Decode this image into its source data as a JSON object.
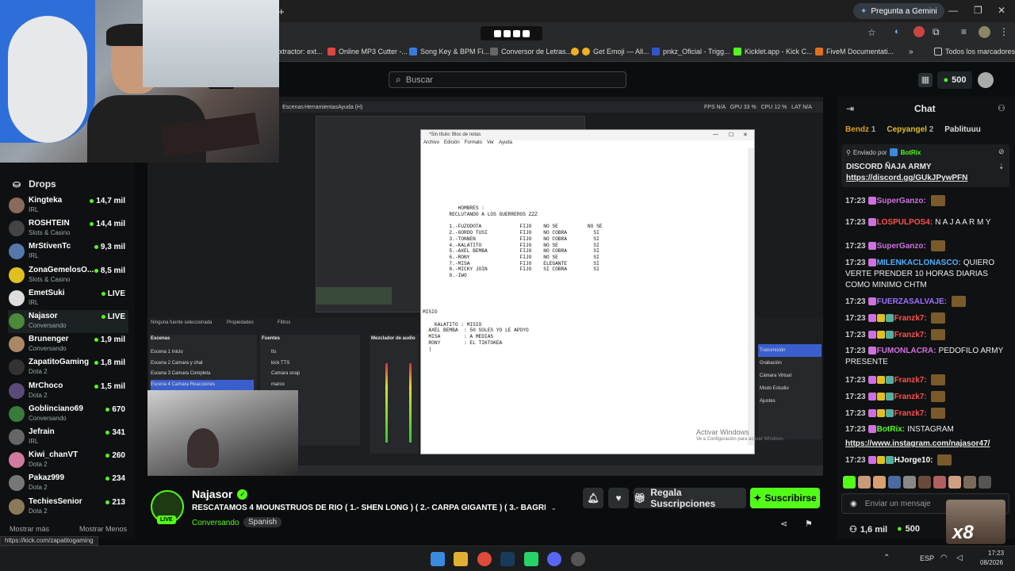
{
  "browser": {
    "ask_gemini": "Pregunta a Gemini",
    "bookmarks": [
      {
        "label": "xtractor: ext...",
        "color": "#888"
      },
      {
        "label": "Online MP3 Cutter -...",
        "color": "#e04444"
      },
      {
        "label": "Song Key & BPM Fi...",
        "color": "#3a7ae0"
      },
      {
        "label": "Conversor de Letras...",
        "color": "#666"
      },
      {
        "label": "Get Emoji — All...",
        "color": "#f0b020"
      },
      {
        "label": "pnkz_Oficial - Trigg...",
        "color": "#3355cc"
      },
      {
        "label": "Kicklet.app - Kick C...",
        "color": "#53fc18"
      },
      {
        "label": "FiveM Documentati...",
        "color": "#e07020"
      }
    ],
    "all_bookmarks": "Todos los marcadores",
    "status_url": "https://kick.com/zapatitogaming"
  },
  "header": {
    "search_placeholder": "Buscar",
    "points": "500"
  },
  "sidebar": {
    "drops_label": "Drops",
    "channels": [
      {
        "name": "Kingteka",
        "category": "IRL",
        "viewers": "14,7 mil",
        "color": "#8a6a5a"
      },
      {
        "name": "ROSHTEIN",
        "category": "Slots & Casino",
        "viewers": "14,4 mil",
        "color": "#444"
      },
      {
        "name": "MrStivenTc",
        "category": "IRL",
        "viewers": "9,3 mil",
        "color": "#5577aa"
      },
      {
        "name": "ZonaGemelosO...",
        "category": "Slots & Casino",
        "viewers": "8,5 mil",
        "color": "#e0c020"
      },
      {
        "name": "EmetSuki",
        "category": "IRL",
        "viewers": "LIVE",
        "color": "#ddd"
      },
      {
        "name": "Najasor",
        "category": "Conversando",
        "viewers": "LIVE",
        "color": "#4a8a3a"
      },
      {
        "name": "Brunenger",
        "category": "Conversando",
        "viewers": "1,9 mil",
        "color": "#aa8866"
      },
      {
        "name": "ZapatitoGaming",
        "category": "Dota 2",
        "viewers": "1,8 mil",
        "color": "#333"
      },
      {
        "name": "MrChoco",
        "category": "Dota 2",
        "viewers": "1,5 mil",
        "color": "#5a4a7a"
      },
      {
        "name": "Goblinciano69",
        "category": "Conversando",
        "viewers": "670",
        "color": "#3a7a3a"
      },
      {
        "name": "Jefrain",
        "category": "IRL",
        "viewers": "341",
        "color": "#666"
      },
      {
        "name": "Kiwi_chanVT",
        "category": "Dota 2",
        "viewers": "260",
        "color": "#d07aa0"
      },
      {
        "name": "Pakaz999",
        "category": "Dota 2",
        "viewers": "234",
        "color": "#777"
      },
      {
        "name": "TechiesSenior",
        "category": "Dota 2",
        "viewers": "213",
        "color": "#8a7a5a"
      }
    ],
    "show_more": "Mostrar más",
    "show_less": "Mostrar Menos"
  },
  "stream": {
    "notepad_title": "*Sin título: Bloc de notas",
    "notepad_menu": [
      "Archivo",
      "Edición",
      "Formato",
      "Ver",
      "Ayuda"
    ],
    "notepad_text": "\n\n\n\n\n\n\n\n\n            HOMBRES :\n         RECLUTANDO A LOS GUERREROS ZZZ\n\n         1.-FUZODOTA             FIJO    NO SE          NO SE\n         2.-GORDO TUSI           FIJO    NO COBRA         SI\n         3.-TONNEN               FIJO    NO COBRA         SI\n         4.-KALATITO             FIJO    NO SE            SI\n         5.-AXEL BEMBA           FIJO    NO COBRA         SI\n         6.-RONY                 FIJO    NO SE            SI\n         7.-MISA                 FIJO    ELEGANTE         SI\n         8.-MICKY JOIN           FIJO    SI COBRA         SI\n         9.-IWO\n\n\n\n\n\nMISIO\n\n    KALATITO : MISIO\n  AXEL BEMBA  : 50 SOLES YO LE APOYO\n  MISA        : A MEDIAS\n  RONY        : EL TIKTOKEA\n  |",
    "watermark": "Activar Windows",
    "watermark_sub": "Ve a Configuración para activar Windows.",
    "obs_menu": [
      "Escenas",
      "Herramientas",
      "Ayuda (H)"
    ],
    "obs_stats": "FPS N/A   GPU 33 %   CPU 12 %   LAT N/A",
    "obs_scenes_title": "Escenas",
    "obs_scenes": [
      "Escena 1 Inicio",
      "Escena 2 Camara y chat",
      "Escena 3 Camara Completa",
      "Escena 4 Camara Reacciones"
    ],
    "obs_sources_title": "Fuentes",
    "obs_sources": [
      "tts",
      "kick TTS",
      "Camara snap",
      "marco"
    ],
    "obs_mixer_title": "Mezclador de audio",
    "obs_controls": [
      "Transmisión",
      "Grabación",
      "Cámara Virtual",
      "Modo Estudio",
      "Ajustes"
    ],
    "obs_no_source": "Ninguna fuente seleccionada",
    "obs_props": "Propiedades",
    "obs_filters": "Filtros"
  },
  "stream_info": {
    "channel": "Najasor",
    "title": "RESCATAMOS 4 MOUNSTRUOS DE RIO   ( 1.- SHEN LONG )  ( 2.- CARPA GIGANTE )  ( 3.- BAGRE T...",
    "category": "Conversando",
    "language": "Spanish",
    "live_badge": "LIVE",
    "gift_button": "Regala Suscripciones",
    "subscribe_button": "Suscribirse"
  },
  "chat": {
    "title": "Chat",
    "top_gifters": [
      {
        "name": "Bendz",
        "count": "1",
        "color": "#e0a020"
      },
      {
        "name": "Cepyangel",
        "count": "2",
        "color": "#e0c020"
      },
      {
        "name": "Pablituuu",
        "count": "",
        "color": "#ccc"
      }
    ],
    "pinned_by_label": "Enviado por",
    "pinned_by": "BotRix",
    "pinned_text": "DISCORD ÑAJA ARMY",
    "pinned_link": "https://discord.gg/GUkJPywPFN",
    "messages": [
      {
        "time": "17:23",
        "user": "SuperGanzo:",
        "color": "#d070e0",
        "text": ""
      },
      {
        "time": "17:23",
        "user": "LOSPULPOS4:",
        "color": "#ff5050",
        "text": "N A J A A R M Y"
      },
      {
        "time": "17:23",
        "user": "SuperGanzo:",
        "color": "#d070e0",
        "text": ""
      },
      {
        "time": "17:23",
        "user": "MILENKACLONASCO:",
        "color": "#50b0ff",
        "text": "QUIERO VERTE PRENDER 10 HORAS DIARIAS COMO MINIMO CHTM"
      },
      {
        "time": "17:23",
        "user": "FUERZASALVAJE:",
        "color": "#a070ff",
        "text": ""
      },
      {
        "time": "17:23",
        "user": "Franzk7:",
        "color": "#ff5050",
        "text": ""
      },
      {
        "time": "17:23",
        "user": "Franzk7:",
        "color": "#ff5050",
        "text": ""
      },
      {
        "time": "17:23",
        "user": "FUMONLACRA:",
        "color": "#d070e0",
        "text": "PEDOFILO ARMY PRESENTE"
      },
      {
        "time": "17:23",
        "user": "Franzk7:",
        "color": "#ff5050",
        "text": ""
      },
      {
        "time": "17:23",
        "user": "Franzk7:",
        "color": "#ff5050",
        "text": ""
      },
      {
        "time": "17:23",
        "user": "Franzk7:",
        "color": "#ff5050",
        "text": ""
      },
      {
        "time": "17:23",
        "user": "BotRix:",
        "color": "#53fc18",
        "text": "INSTAGRAM"
      },
      {
        "time": "17:23",
        "user": "HJorge10:",
        "color": "#fff",
        "text": ""
      }
    ],
    "instagram_link": "https://www.instagram.com/najasor47/",
    "input_placeholder": "Enviar un mensaje",
    "followers": "1,6 mil",
    "points": "500",
    "multiplier": "x8"
  },
  "taskbar": {
    "lang": "ESP",
    "time": "17:23",
    "date": "08/2026"
  }
}
